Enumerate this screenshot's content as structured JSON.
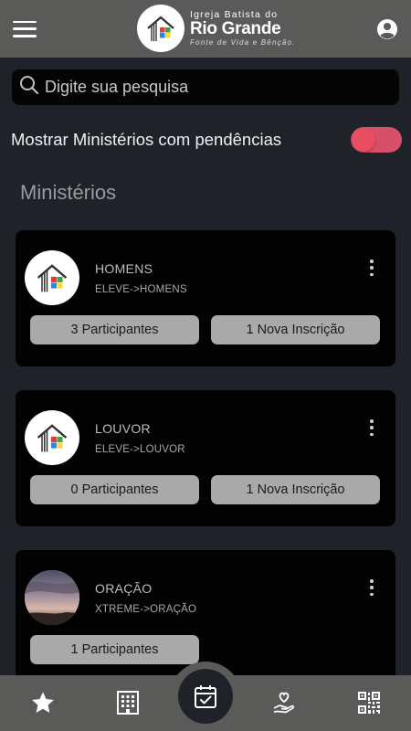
{
  "header": {
    "brand_top": "Igreja Batista do",
    "brand_main": "Rio Grande",
    "brand_sub": "Fonte de Vida e Bênção."
  },
  "search": {
    "placeholder": "Digite sua pesquisa"
  },
  "filter": {
    "label": "Mostrar Ministérios com pendências",
    "enabled": true
  },
  "section_title": "Ministérios",
  "ministries": [
    {
      "name": "HOMENS",
      "path": "ELEVE->HOMENS",
      "participants": "3 Participantes",
      "inscriptions": "1 Nova Inscrição",
      "avatar": "church-logo"
    },
    {
      "name": "LOUVOR",
      "path": "ELEVE->LOUVOR",
      "participants": "0 Participantes",
      "inscriptions": "1 Nova Inscrição",
      "avatar": "church-logo"
    },
    {
      "name": "ORAÇÃO",
      "path": "XTREME->ORAÇÃO",
      "participants": "1 Participantes",
      "avatar": "sunset-photo"
    }
  ],
  "bottom_nav": [
    "star-icon",
    "building-icon",
    "calendar-check-icon",
    "hand-heart-icon",
    "qr-code-icon"
  ],
  "colors": {
    "header": "#5a5a58",
    "background": "#1f2329",
    "card": "#020202",
    "pill": "#a9a9a9",
    "toggle": "#e84e5f"
  }
}
